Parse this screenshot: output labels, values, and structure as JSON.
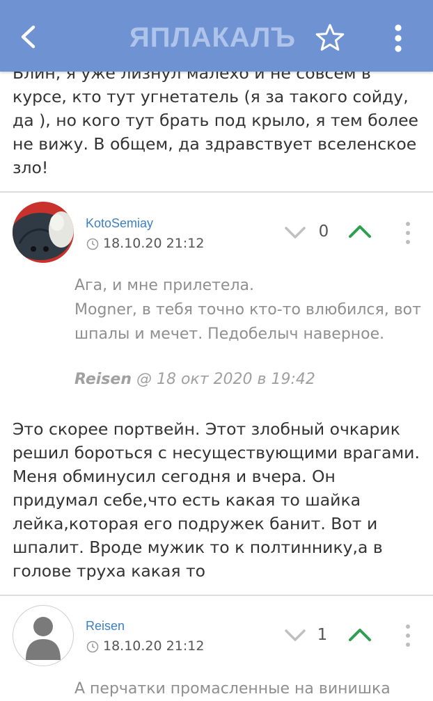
{
  "header": {
    "logo_text": "ЯПЛАКАЛЪ",
    "bar_color": "#6f93d2"
  },
  "posts": [
    {
      "body": "Блин, я уже лизнул малехо и не совсем в курсе, кто тут угнетатель (я за такого сойду, да ), но кого тут брать под крыло, я тем более не вижу. В общем, да здравствует вселенское зло!"
    },
    {
      "username": "KotoSemiay",
      "timestamp": "18.10.20 21:12",
      "vote_count": "0",
      "quote": "Ага, и мне прилетела.\nMogner, в тебя точно кто-то влюбился, вот шпалы и мечет. Педобелыч наверное.",
      "quote_author": "Reisen",
      "quote_meta": " @ 18 окт 2020 в 19:42",
      "body": "Это скорее портвейн. Этот злобный очкарик решил бороться с несуществующими врагами. Меня обминусил сегодня и вчера. Он придумал себе,что есть какая то шайка лейка,которая его подружек банит. Вот и шпалит. Вроде мужик то к полтиннику,а в голове труха какая то"
    },
    {
      "username": "Reisen",
      "timestamp": "18.10.20 21:12",
      "vote_count": "1",
      "quote_partial": "А перчатки промасленные на винишка"
    }
  ],
  "colors": {
    "username": "#3d7fc2",
    "upvote": "#2e9e4f",
    "downvote": "#bfbfbf"
  }
}
